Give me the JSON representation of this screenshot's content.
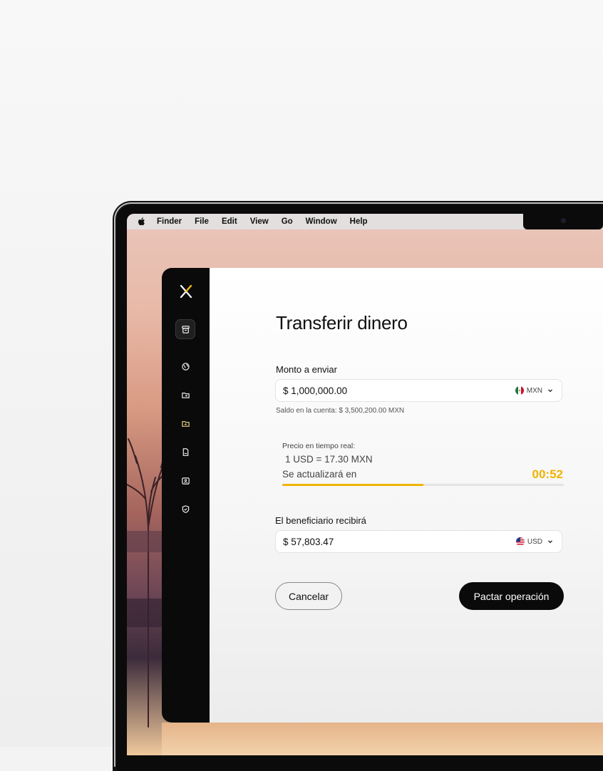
{
  "menubar": {
    "items": [
      "Finder",
      "File",
      "Edit",
      "View",
      "Go",
      "Window",
      "Help"
    ]
  },
  "sidebar": {
    "logo": "x-logo-icon",
    "items": [
      {
        "icon": "archive-icon",
        "active": true
      },
      {
        "icon": "globe-icon",
        "active": false
      },
      {
        "icon": "folder-icon",
        "active": false
      },
      {
        "icon": "folder-highlight-icon",
        "active": false
      },
      {
        "icon": "document-icon",
        "active": false
      },
      {
        "icon": "user-card-icon",
        "active": false
      },
      {
        "icon": "shield-icon",
        "active": false
      }
    ]
  },
  "main": {
    "title": "Transferir dinero",
    "send": {
      "label": "Monto a enviar",
      "value": "$ 1,000,000.00",
      "currency": "MXN",
      "balance": "Saldo en la cuenta: $ 3,500,200.00 MXN"
    },
    "rate": {
      "label": "Precio en tiempo real:",
      "value": "1 USD = 17.30 MXN",
      "update_label": "Se actualizará en",
      "timer": "00:52",
      "progress": 0.5
    },
    "receive": {
      "label": "El beneficiario recibirá",
      "value": "$ 57,803.47",
      "currency": "USD"
    },
    "buttons": {
      "cancel": "Cancelar",
      "confirm": "Pactar operación"
    }
  },
  "colors": {
    "accent": "#f0b400",
    "sidebar": "#0a0a0a",
    "primary_button": "#0a0a0a"
  }
}
